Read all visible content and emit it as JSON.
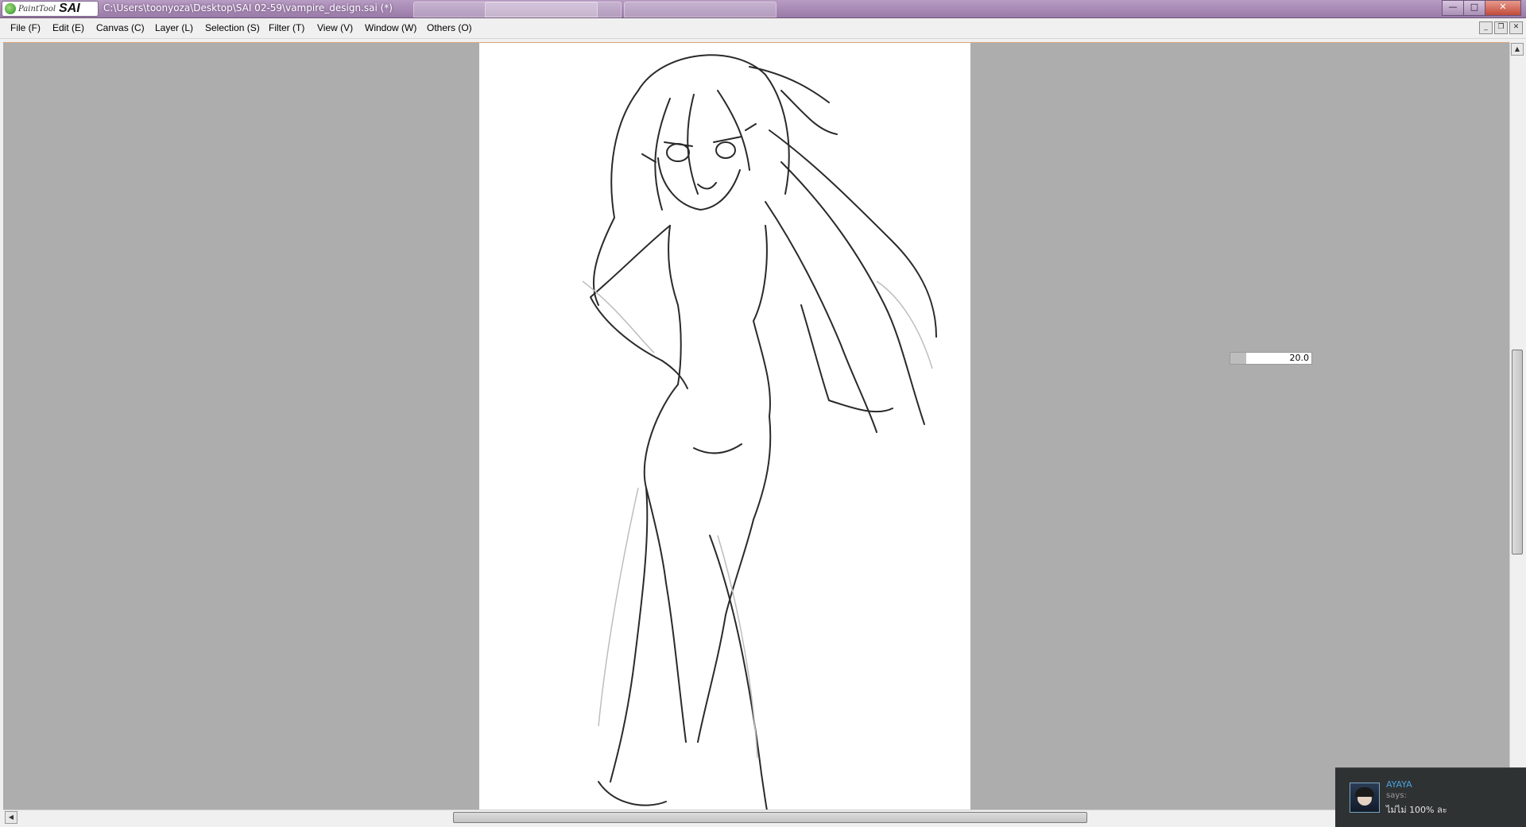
{
  "titlebar": {
    "logo_small": "PaintTool",
    "logo_big": "SAI",
    "path": "C:\\Users\\toonyoza\\Desktop\\SAI 02-59\\vampire_design.sai (*)"
  },
  "menu": {
    "file": "File (F)",
    "edit": "Edit (E)",
    "canvas": "Canvas (C)",
    "layer": "Layer (L)",
    "selection": "Selection (S)",
    "filter": "Filter (T)",
    "view": "View (V)",
    "window": "Window (W)",
    "others": "Others (O)"
  },
  "brush": {
    "size_value": "20.0",
    "fill_fraction": 0.2
  },
  "notification": {
    "name": "AYAYA",
    "says": "says:",
    "message": "ไม่ไม่ 100% ละ"
  },
  "icons": {
    "minimize": "minimize-icon",
    "maximize": "maximize-icon",
    "close": "close-icon",
    "scroll_up": "arrow-up-icon",
    "scroll_left": "arrow-left-icon"
  },
  "colors": {
    "titlebar": "#a98fb6",
    "workspace": "#adadad",
    "paper": "#ffffff",
    "toast_bg": "#2f3233",
    "toast_name": "#4aa3e0"
  }
}
